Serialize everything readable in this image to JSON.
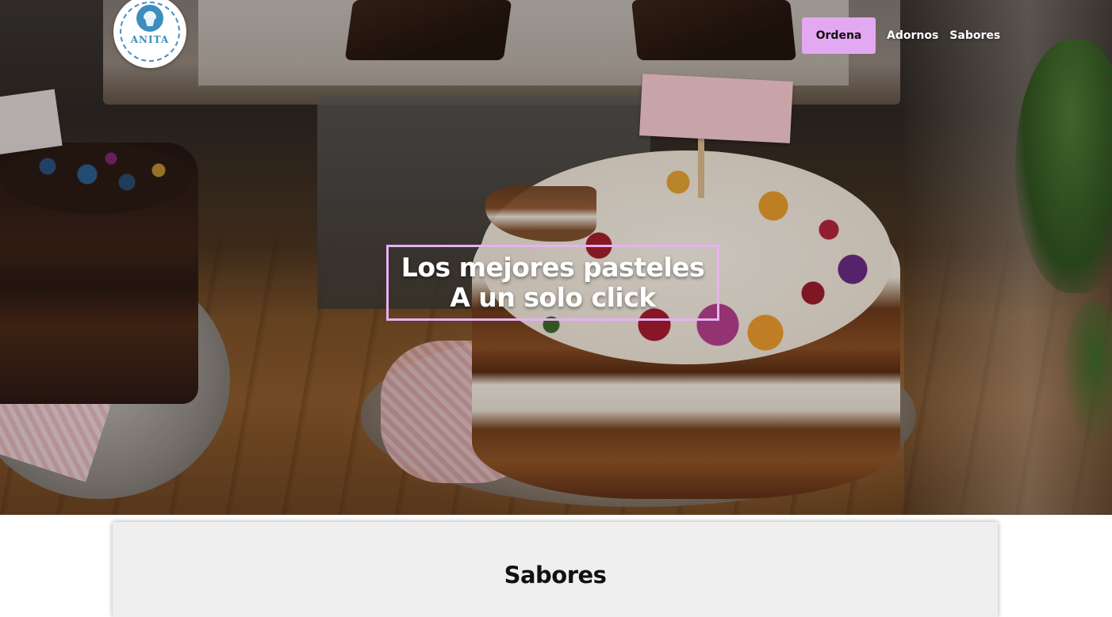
{
  "brand": {
    "logo_text": "ANITA",
    "accent_color": "#e3a8f2",
    "logo_color": "#3d8dbf"
  },
  "nav": {
    "order_label": "Ordena",
    "links": [
      "Adornos",
      "Sabores"
    ]
  },
  "hero": {
    "line1": "Los mejores pasteles",
    "line2": "A un solo click",
    "frame_color": "#e8b0f4"
  },
  "section": {
    "title": "Sabores"
  }
}
